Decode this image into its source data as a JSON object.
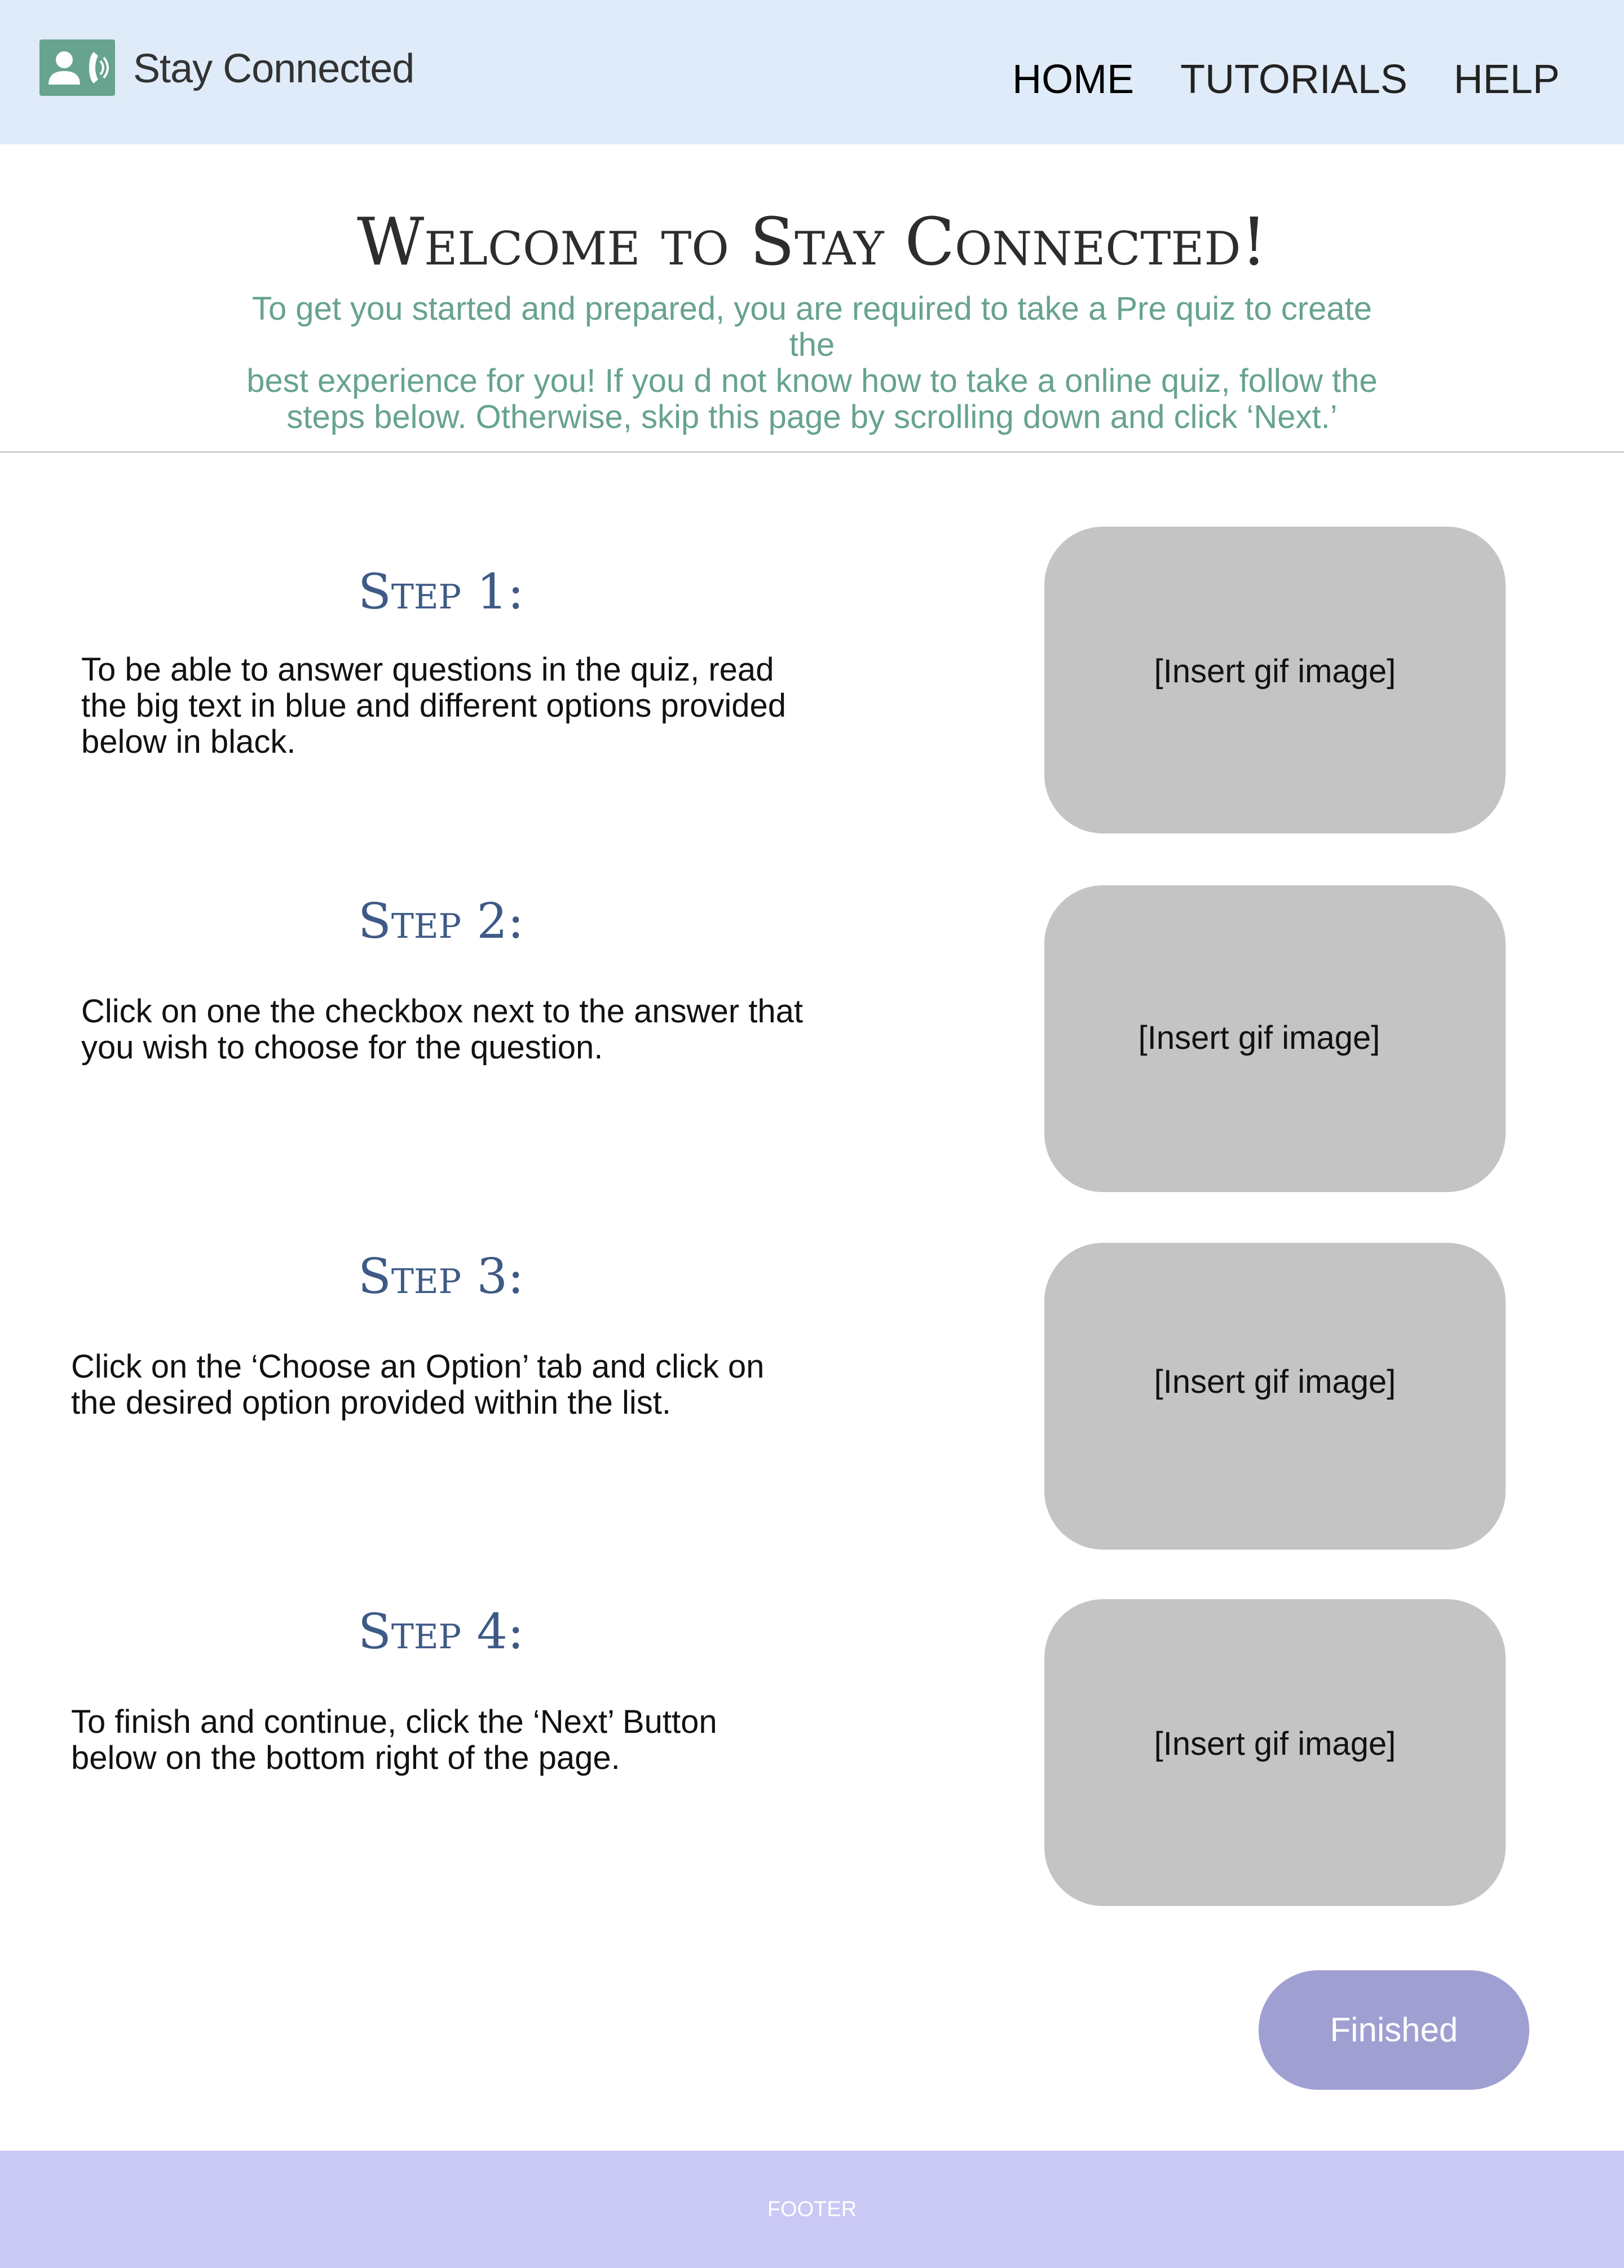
{
  "header": {
    "app_title": "Stay Connected",
    "logo_icon": "contact-phone-icon",
    "nav": [
      {
        "label": "HOME"
      },
      {
        "label": "TUTORIALS"
      },
      {
        "label": "HELP"
      }
    ]
  },
  "welcome": {
    "title": "Welcome to Stay Connected!",
    "subtitle_lines": [
      "To get you started and prepared, you are required to take a Pre quiz to create the",
      "best experience for you! If you d not know how to take a online quiz, follow the",
      "steps below. Otherwise, skip this page by scrolling down and click ‘Next.’"
    ]
  },
  "steps": [
    {
      "heading": "Step 1:",
      "lines": [
        "To be able to answer questions in the quiz, read",
        "the big text in blue and different options provided",
        "below in black."
      ],
      "gif_label": "[Insert gif image]"
    },
    {
      "heading": "Step 2:",
      "lines": [
        "Click on one the checkbox next to the answer that",
        "you wish to choose for the question."
      ],
      "gif_label": "[Insert gif image]"
    },
    {
      "heading": "Step 3:",
      "lines": [
        "Click on the ‘Choose an Option’ tab and click on",
        "the desired option provided within the list."
      ],
      "gif_label": "[Insert gif image]"
    },
    {
      "heading": "Step 4:",
      "lines": [
        "To finish and continue, click the ‘Next’ Button",
        "below on the bottom right of the page."
      ],
      "gif_label": "[Insert gif image]"
    }
  ],
  "finished_button": {
    "label": "Finished"
  },
  "footer": {
    "label": "FOOTER"
  },
  "colors": {
    "header_bg": "#dfebf8",
    "accent_green": "#67a38e",
    "step_heading": "#3e5a86",
    "gif_placeholder": "#c4c4c4",
    "button_bg": "#a09fd2",
    "footer_bg": "#cac8f5"
  }
}
